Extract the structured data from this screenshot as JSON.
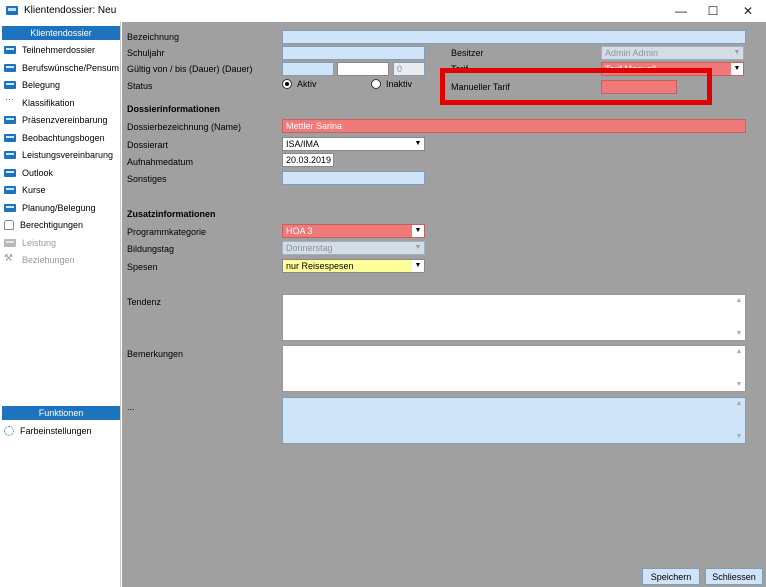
{
  "window": {
    "title": "Klientendossier: Neu",
    "minimize": "—",
    "maximize": "☐",
    "close": "✕"
  },
  "sidebar": {
    "header": "Klientendossier",
    "items": [
      {
        "label": "Teilnehmerdossier",
        "icon": "folder-icon"
      },
      {
        "label": "Berufswünsche/Pensum",
        "icon": "folder-icon"
      },
      {
        "label": "Belegung",
        "icon": "folder-icon"
      },
      {
        "label": "Klassifikation",
        "icon": "dots-icon"
      },
      {
        "label": "Präsenzvereinbarung",
        "icon": "folder-icon"
      },
      {
        "label": "Beobachtungsbogen",
        "icon": "folder-icon"
      },
      {
        "label": "Leistungsvereinbarung",
        "icon": "folder-icon"
      },
      {
        "label": "Outlook",
        "icon": "folder-icon"
      },
      {
        "label": "Kurse",
        "icon": "folder-icon"
      },
      {
        "label": "Planung/Belegung",
        "icon": "folder-icon"
      },
      {
        "label": "Berechtigungen",
        "icon": "person-icon"
      },
      {
        "label": "Leistung",
        "icon": "folder-icon"
      },
      {
        "label": "Beziehungen",
        "icon": "wrench-icon"
      }
    ],
    "functions_header": "Funktionen",
    "functions": [
      {
        "label": "Farbeinstellungen",
        "icon": "palette-icon"
      }
    ]
  },
  "form": {
    "bezeichnung_label": "Bezeichnung",
    "schuljahr_label": "Schuljahr",
    "gueltig_label": "Gültig von / bis (Dauer) (Dauer)",
    "dauer_value": "0",
    "status_label": "Status",
    "status_aktiv": "Aktiv",
    "status_inaktiv": "Inaktiv",
    "besitzer_label": "Besitzer",
    "besitzer_value": "Admin Admin",
    "tarif_label": "Tarif",
    "tarif_value": "Tarif Manuell",
    "manueller_tarif_label": "Manueller Tarif",
    "dossierinfo_header": "Dossierinformationen",
    "dossierbez_label": "Dossierbezeichnung (Name)",
    "dossierbez_value": "Mettler Sarina",
    "dossierart_label": "Dossierart",
    "dossierart_value": "ISA/IMA",
    "aufnahmedatum_label": "Aufnahmedatum",
    "aufnahmedatum_value": "20.03.2019",
    "sonstiges_label": "Sonstiges",
    "zusatzinfo_header": "Zusatzinformationen",
    "programmkategorie_label": "Programmkategorie",
    "programmkategorie_value": "HOA 3",
    "bildungstag_label": "Bildungstag",
    "bildungstag_value": "Donnerstag",
    "spesen_label": "Spesen",
    "spesen_value": "nur Reisespesen",
    "tendenz_label": "Tendenz",
    "bemerkungen_label": "Bemerkungen",
    "ellipsis_label": "..."
  },
  "buttons": {
    "save": "Speichern",
    "close": "Schliessen"
  },
  "colors": {
    "accent": "#1e73be",
    "field_blue": "#cfe3f9",
    "field_red": "#f07a7a",
    "field_yellow": "#ffff9a",
    "highlight": "#e00000",
    "panel": "#a0a0a0"
  }
}
